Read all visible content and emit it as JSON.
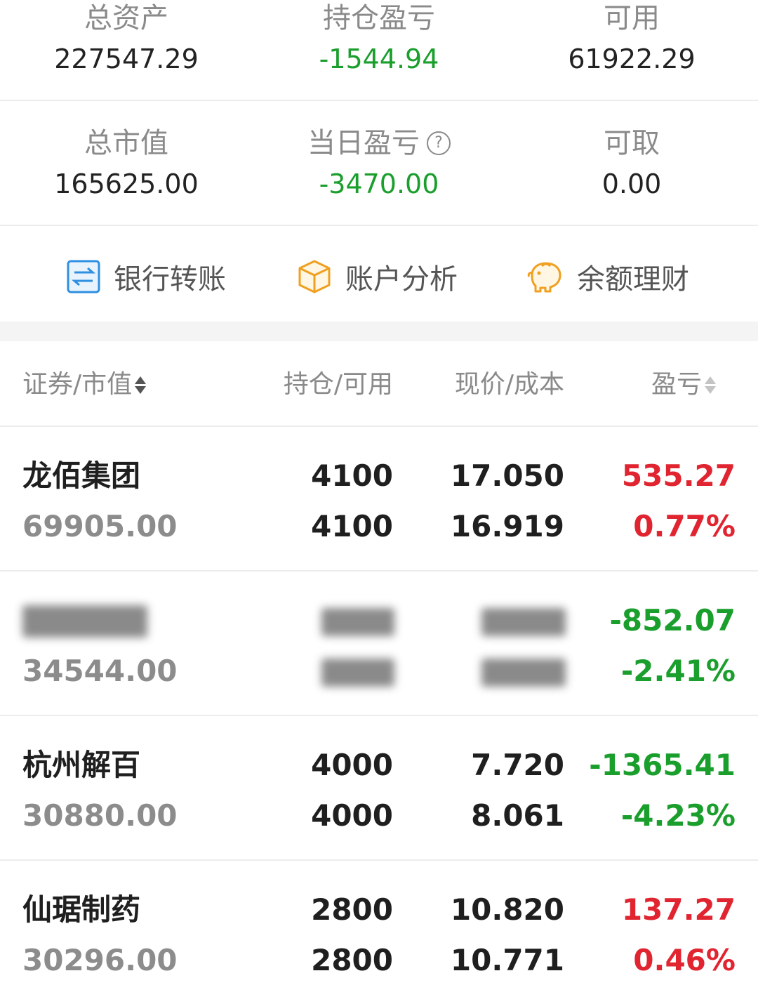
{
  "summary": {
    "total_assets_label": "总资产",
    "total_assets": "227547.29",
    "position_pl_label": "持仓盈亏",
    "position_pl": "-1544.94",
    "available_label": "可用",
    "available": "61922.29",
    "market_value_label": "总市值",
    "market_value": "165625.00",
    "daily_pl_label": "当日盈亏",
    "daily_pl": "-3470.00",
    "withdrawable_label": "可取",
    "withdrawable": "0.00"
  },
  "actions": {
    "bank_transfer": "银行转账",
    "account_analysis": "账户分析",
    "balance_finance": "余额理财"
  },
  "table": {
    "col_security": "证券/市值",
    "col_position": "持仓/可用",
    "col_price": "现价/成本",
    "col_pl": "盈亏"
  },
  "holdings": [
    {
      "name": "龙佰集团",
      "market_value": "69905.00",
      "position": "4100",
      "available": "4100",
      "price": "17.050",
      "cost": "16.919",
      "pl": "535.27",
      "pl_pct": "0.77%",
      "status": "up"
    },
    {
      "name": "",
      "market_value": "34544.00",
      "position": "",
      "available": "",
      "price": "",
      "cost": "",
      "pl": "-852.07",
      "pl_pct": "-2.41%",
      "status": "down"
    },
    {
      "name": "杭州解百",
      "market_value": "30880.00",
      "position": "4000",
      "available": "4000",
      "price": "7.720",
      "cost": "8.061",
      "pl": "-1365.41",
      "pl_pct": "-4.23%",
      "status": "down"
    },
    {
      "name": "仙琚制药",
      "market_value": "30296.00",
      "position": "2800",
      "available": "2800",
      "price": "10.820",
      "cost": "10.771",
      "pl": "137.27",
      "pl_pct": "0.46%",
      "status": "up"
    }
  ],
  "colors": {
    "up": "#e02430",
    "down": "#1a9e2c",
    "accent_blue": "#2f8fe0",
    "accent_orange": "#f0a020"
  },
  "icons": [
    "bank-transfer-icon",
    "cube-icon",
    "piggy-bank-icon",
    "help-icon",
    "sort-icon"
  ]
}
